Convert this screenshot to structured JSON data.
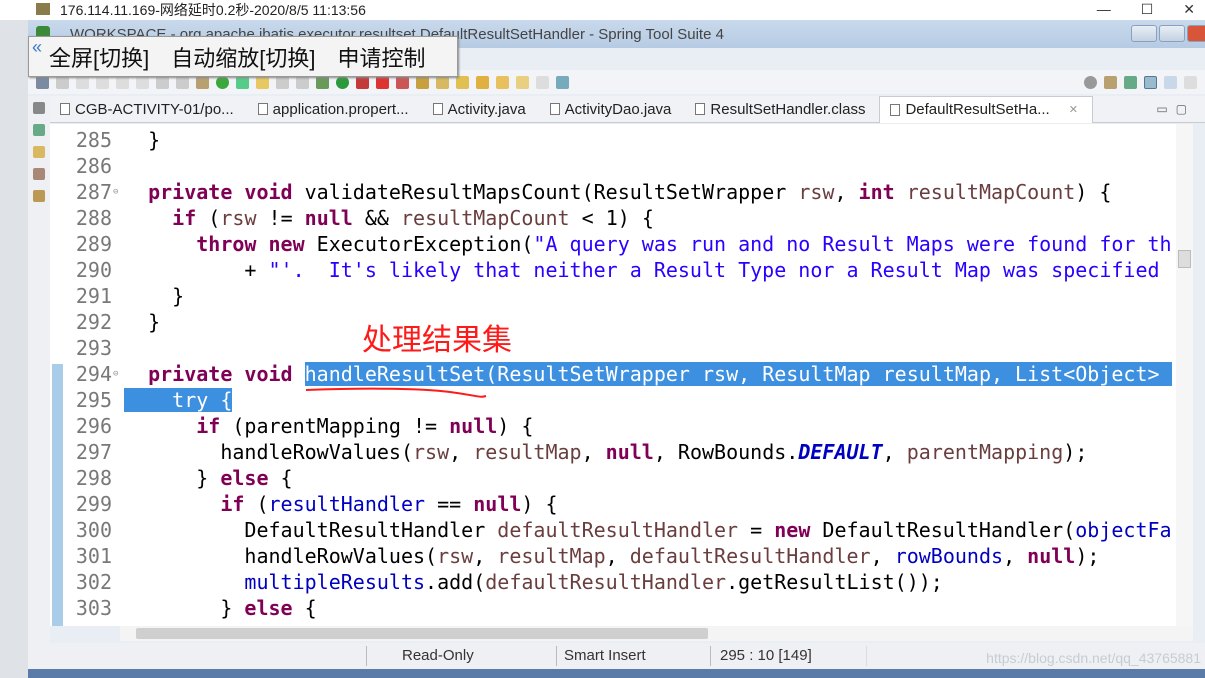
{
  "remote_title": "176.114.11.169-网络延时0.2秒-2020/8/5 11:13:56",
  "remote_window_controls": [
    "—",
    "☐",
    "✕"
  ],
  "window_title": "WORKSPACE - org.apache.ibatis.executor.resultset.DefaultResultSetHandler - Spring Tool Suite 4",
  "remote_bar": {
    "collapse_icon": "«",
    "items": [
      "全屏[切换]",
      "自动缩放[切换]",
      "申请控制"
    ]
  },
  "tabs": [
    {
      "label": "CGB-ACTIVITY-01/po...",
      "active": false
    },
    {
      "label": "application.propert...",
      "active": false
    },
    {
      "label": "Activity.java",
      "active": false
    },
    {
      "label": "ActivityDao.java",
      "active": false
    },
    {
      "label": "ResultSetHandler.class",
      "active": false
    },
    {
      "label": "DefaultResultSetHa...",
      "active": true,
      "close": "✕"
    }
  ],
  "annotation": "处理结果集",
  "code_lines": [
    {
      "n": "285",
      "fold": "",
      "tokens": [
        {
          "t": "  }",
          "c": ""
        }
      ]
    },
    {
      "n": "286",
      "fold": "",
      "tokens": []
    },
    {
      "n": "287",
      "fold": "⊖",
      "tokens": [
        {
          "t": "  ",
          "c": ""
        },
        {
          "t": "private void",
          "c": "k"
        },
        {
          "t": " validateResultMapsCount(ResultSetWrapper ",
          "c": ""
        },
        {
          "t": "rsw",
          "c": "v"
        },
        {
          "t": ", ",
          "c": ""
        },
        {
          "t": "int",
          "c": "k"
        },
        {
          "t": " ",
          "c": ""
        },
        {
          "t": "resultMapCount",
          "c": "v"
        },
        {
          "t": ") {",
          "c": ""
        }
      ]
    },
    {
      "n": "288",
      "fold": "",
      "tokens": [
        {
          "t": "    ",
          "c": ""
        },
        {
          "t": "if",
          "c": "k"
        },
        {
          "t": " (",
          "c": ""
        },
        {
          "t": "rsw",
          "c": "v"
        },
        {
          "t": " != ",
          "c": ""
        },
        {
          "t": "null",
          "c": "k"
        },
        {
          "t": " && ",
          "c": ""
        },
        {
          "t": "resultMapCount",
          "c": "v"
        },
        {
          "t": " < 1) {",
          "c": ""
        }
      ]
    },
    {
      "n": "289",
      "fold": "",
      "tokens": [
        {
          "t": "      ",
          "c": ""
        },
        {
          "t": "throw new",
          "c": "k"
        },
        {
          "t": " ExecutorException(",
          "c": ""
        },
        {
          "t": "\"A query was run and no Result Maps were found for th",
          "c": "s"
        }
      ]
    },
    {
      "n": "290",
      "fold": "",
      "tokens": [
        {
          "t": "          + ",
          "c": ""
        },
        {
          "t": "\"'.  It's likely that neither a Result Type nor a Result Map was specified",
          "c": "s"
        }
      ]
    },
    {
      "n": "291",
      "fold": "",
      "tokens": [
        {
          "t": "    }",
          "c": ""
        }
      ]
    },
    {
      "n": "292",
      "fold": "",
      "tokens": [
        {
          "t": "  }",
          "c": ""
        }
      ]
    },
    {
      "n": "293",
      "fold": "",
      "tokens": []
    },
    {
      "n": "294",
      "fold": "⊖",
      "tokens": [
        {
          "t": "  ",
          "c": ""
        },
        {
          "t": "private void",
          "c": "k"
        },
        {
          "t": " ",
          "c": ""
        },
        {
          "t": "handleResultSet(ResultSetWrapper rsw, ResultMap resultMap, List<Object> ",
          "c": "sel"
        }
      ]
    },
    {
      "n": "295",
      "fold": "",
      "tokens": [
        {
          "t": "    try {",
          "c": "sel"
        }
      ]
    },
    {
      "n": "296",
      "fold": "",
      "tokens": [
        {
          "t": "      ",
          "c": ""
        },
        {
          "t": "if",
          "c": "k"
        },
        {
          "t": " (parentMapping != ",
          "c": ""
        },
        {
          "t": "null",
          "c": "k"
        },
        {
          "t": ") {",
          "c": ""
        }
      ]
    },
    {
      "n": "297",
      "fold": "",
      "tokens": [
        {
          "t": "        handleRowValues(",
          "c": ""
        },
        {
          "t": "rsw",
          "c": "v"
        },
        {
          "t": ", ",
          "c": ""
        },
        {
          "t": "resultMap",
          "c": "v"
        },
        {
          "t": ", ",
          "c": ""
        },
        {
          "t": "null",
          "c": "k"
        },
        {
          "t": ", RowBounds.",
          "c": ""
        },
        {
          "t": "DEFAULT",
          "c": "i"
        },
        {
          "t": ", ",
          "c": ""
        },
        {
          "t": "parentMapping",
          "c": "v"
        },
        {
          "t": ");",
          "c": ""
        }
      ]
    },
    {
      "n": "298",
      "fold": "",
      "tokens": [
        {
          "t": "      } ",
          "c": ""
        },
        {
          "t": "else",
          "c": "k"
        },
        {
          "t": " {",
          "c": ""
        }
      ]
    },
    {
      "n": "299",
      "fold": "",
      "tokens": [
        {
          "t": "        ",
          "c": ""
        },
        {
          "t": "if",
          "c": "k"
        },
        {
          "t": " (",
          "c": ""
        },
        {
          "t": "resultHandler",
          "c": "f"
        },
        {
          "t": " == ",
          "c": ""
        },
        {
          "t": "null",
          "c": "k"
        },
        {
          "t": ") {",
          "c": ""
        }
      ]
    },
    {
      "n": "300",
      "fold": "",
      "tokens": [
        {
          "t": "          DefaultResultHandler ",
          "c": ""
        },
        {
          "t": "defaultResultHandler",
          "c": "v"
        },
        {
          "t": " = ",
          "c": ""
        },
        {
          "t": "new",
          "c": "k"
        },
        {
          "t": " DefaultResultHandler(",
          "c": ""
        },
        {
          "t": "objectFa",
          "c": "f"
        }
      ]
    },
    {
      "n": "301",
      "fold": "",
      "tokens": [
        {
          "t": "          handleRowValues(",
          "c": ""
        },
        {
          "t": "rsw",
          "c": "v"
        },
        {
          "t": ", ",
          "c": ""
        },
        {
          "t": "resultMap",
          "c": "v"
        },
        {
          "t": ", ",
          "c": ""
        },
        {
          "t": "defaultResultHandler",
          "c": "v"
        },
        {
          "t": ", ",
          "c": ""
        },
        {
          "t": "rowBounds",
          "c": "f"
        },
        {
          "t": ", ",
          "c": ""
        },
        {
          "t": "null",
          "c": "k"
        },
        {
          "t": ");",
          "c": ""
        }
      ]
    },
    {
      "n": "302",
      "fold": "",
      "tokens": [
        {
          "t": "          ",
          "c": ""
        },
        {
          "t": "multipleResults",
          "c": "f"
        },
        {
          "t": ".add(",
          "c": ""
        },
        {
          "t": "defaultResultHandler",
          "c": "v"
        },
        {
          "t": ".getResultList());",
          "c": ""
        }
      ]
    },
    {
      "n": "303",
      "fold": "",
      "tokens": [
        {
          "t": "        } ",
          "c": ""
        },
        {
          "t": "else",
          "c": "k"
        },
        {
          "t": " {",
          "c": ""
        }
      ]
    }
  ],
  "status": {
    "mode": "Read-Only",
    "insert": "Smart Insert",
    "position": "295 : 10 [149]"
  },
  "watermark": "https://blog.csdn.net/qq_43765881",
  "colors": {
    "keyword": "#7f0055",
    "string": "#2a00ff",
    "field": "#0000c0",
    "selection": "#3d8fe0",
    "annotation": "#ff1a1a"
  }
}
